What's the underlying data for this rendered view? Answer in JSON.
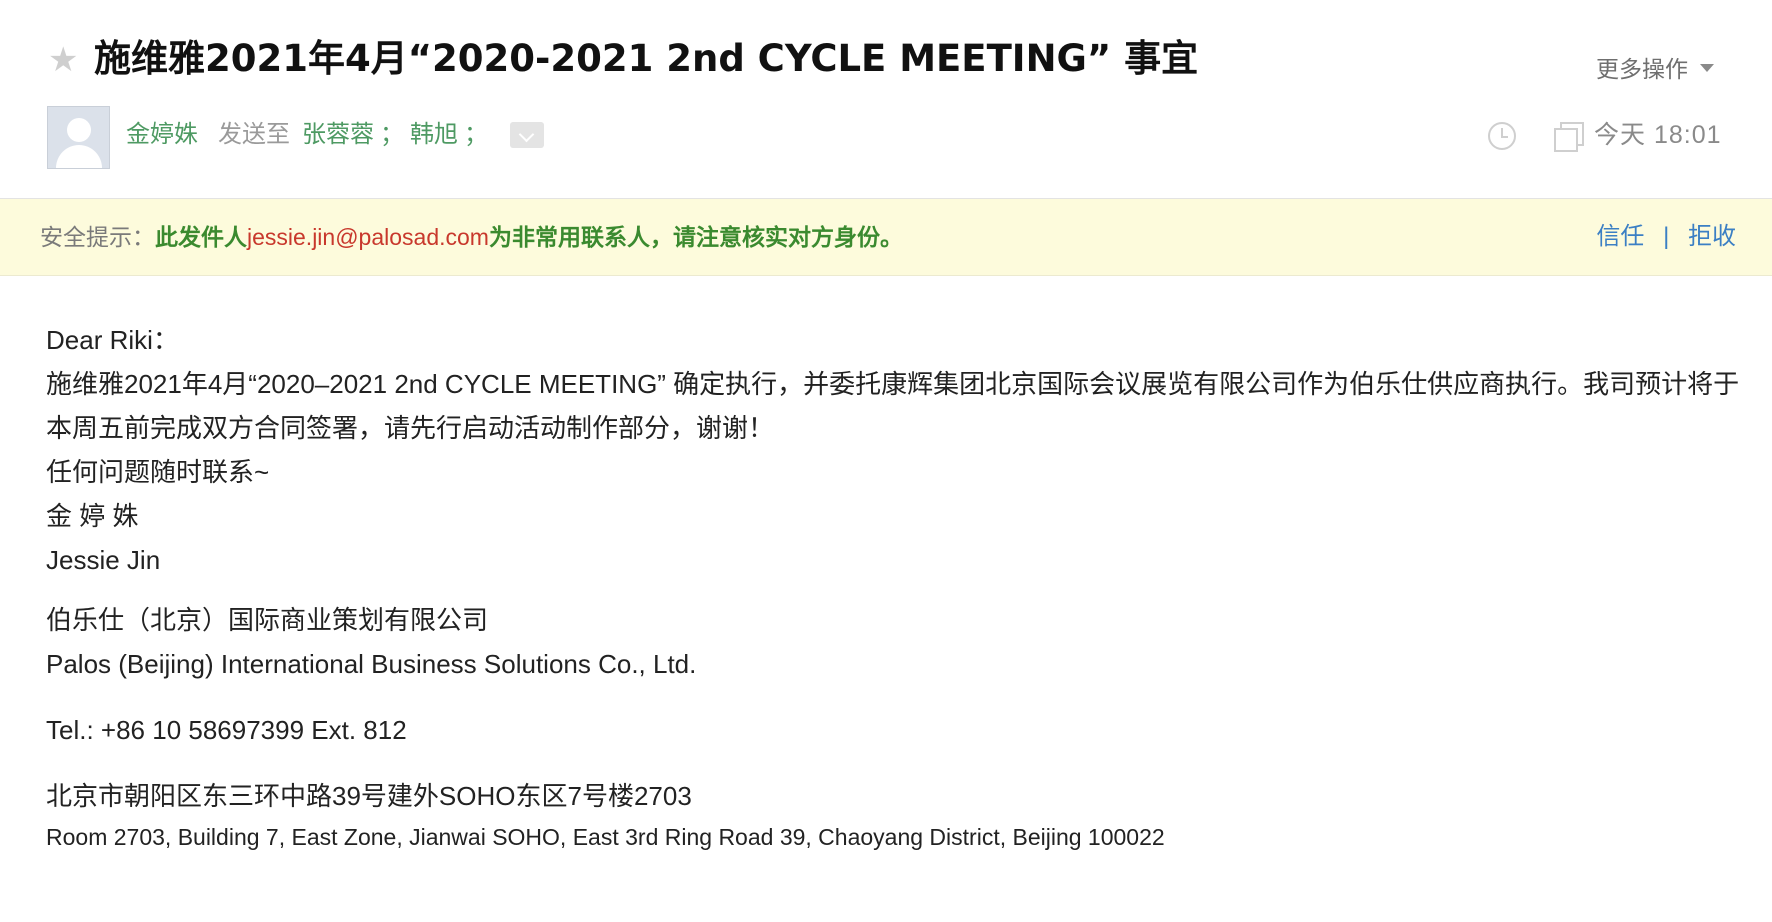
{
  "header": {
    "subject": "施维雅2021年4月“2020-2021 2nd CYCLE MEETING” 事宜",
    "more_actions": "更多操作",
    "sender_name": "金婷姝",
    "sent_to_label": "发送至",
    "recipients": [
      "张蓉蓉",
      "韩旭"
    ],
    "separator": "；",
    "datetime": "今天 18:01",
    "icons": {
      "star": "star-icon",
      "avatar": "avatar-icon",
      "expand": "chevron-down-icon",
      "clock": "clock-icon",
      "copy": "copy-icon"
    }
  },
  "security": {
    "label": "安全提示：",
    "prefix": "此发件人",
    "email": "jessie.jin@palosad.com",
    "suffix": "为非常用联系人，请注意核实对方身份。",
    "trust": "信任",
    "divider": "|",
    "reject": "拒收"
  },
  "body": {
    "greeting": "Dear Riki：",
    "paragraph": "施维雅2021年4月“2020–2021 2nd CYCLE MEETING” 确定执行，并委托康辉集团北京国际会议展览有限公司作为伯乐仕供应商执行。我司预计将于本周五前完成双方合同签署，请先行启动活动制作部分，谢谢！",
    "followup": "任何问题随时联系~",
    "signature_cn": "金 婷 姝",
    "signature_en": "Jessie Jin",
    "company_cn": "伯乐仕（北京）国际商业策划有限公司",
    "company_en": "Palos (Beijing) International Business Solutions Co., Ltd.",
    "tel": "Tel.: +86 10 58697399 Ext. 812",
    "address_cn": "北京市朝阳区东三环中路39号建外SOHO东区7号楼2703",
    "address_en": "Room 2703, Building 7, East Zone, Jianwai SOHO, East 3rd Ring Road 39, Chaoyang District, Beijing 100022"
  },
  "colors": {
    "sender_green": "#4e9a63",
    "security_bg": "#fdfbdc",
    "security_green": "#3b8a2f",
    "email_red": "#c8382c",
    "link_blue": "#3b7fc4"
  }
}
